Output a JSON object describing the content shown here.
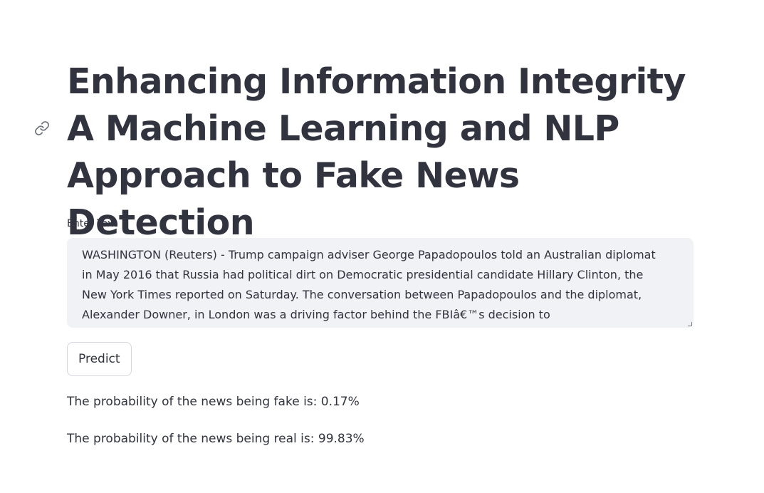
{
  "page": {
    "title": "Enhancing Information Integrity A Machine Learning and NLP Approach to Fake News Detection"
  },
  "input": {
    "label": "Enter Text",
    "value": "WASHINGTON (Reuters) - Trump campaign adviser George Papadopoulos told an Australian diplomat in May 2016 that Russia had political dirt on Democratic presidential candidate Hillary Clinton, the New York Times reported on Saturday. The conversation between Papadopoulos and the diplomat, Alexander Downer, in London was a driving factor behind the FBIâ€™s decision to"
  },
  "actions": {
    "predict_label": "Predict"
  },
  "results": {
    "fake_text": "The probability of the news being fake is: 0.17%",
    "real_text": "The probability of the news being real is: 99.83%"
  },
  "icons": {
    "anchor": "link-icon"
  }
}
